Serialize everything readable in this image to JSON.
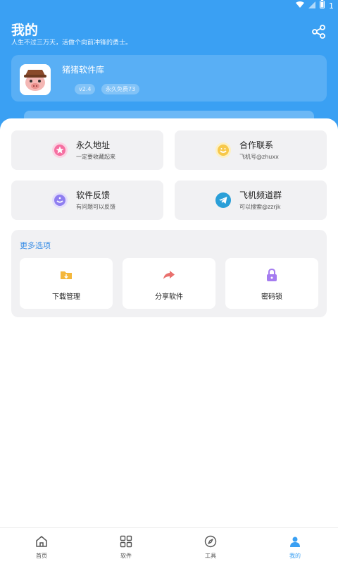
{
  "status_bar": {
    "wifi_icon": "wifi-icon",
    "signal_icon": "signal-icon",
    "battery_icon": "battery-icon",
    "time": "1"
  },
  "header": {
    "title": "我的",
    "subtitle": "人生不过三万天，活做个向前冲锋的勇士。",
    "share_icon": "share-icon",
    "background_color": "#3aa0f3"
  },
  "profile": {
    "name": "猪猪软件库",
    "version": "v2.4",
    "badge": "永久免费73",
    "avatar_icon": "pig-avatar-icon"
  },
  "menu_cards": [
    {
      "title": "永久地址",
      "subtitle": "一定要收藏起来",
      "icon": "star-icon",
      "icon_color": "#f56fa1"
    },
    {
      "title": "合作联系",
      "subtitle": "飞机号@zhuxx",
      "icon": "smile-icon",
      "icon_color": "#f7c84a"
    },
    {
      "title": "软件反馈",
      "subtitle": "有问题可以反馈",
      "icon": "feedback-icon",
      "icon_color": "#8f7ef0"
    },
    {
      "title": "飞机频道群",
      "subtitle": "可以搜索@zzrjk",
      "icon": "telegram-icon",
      "icon_color": "#2a9fd8"
    }
  ],
  "more": {
    "title": "更多选项",
    "title_color": "#3a8ee6",
    "options": [
      {
        "label": "下载管理",
        "icon": "download-folder-icon",
        "icon_color": "#f4b73c"
      },
      {
        "label": "分享软件",
        "icon": "share-arrow-icon",
        "icon_color": "#e9706d"
      },
      {
        "label": "密码锁",
        "icon": "lock-icon",
        "icon_color": "#a57cf0"
      }
    ]
  },
  "tabbar": [
    {
      "label": "首页",
      "icon": "home-icon"
    },
    {
      "label": "软件",
      "icon": "grid-icon"
    },
    {
      "label": "工具",
      "icon": "compass-icon"
    },
    {
      "label": "我的",
      "icon": "profile-icon"
    }
  ]
}
